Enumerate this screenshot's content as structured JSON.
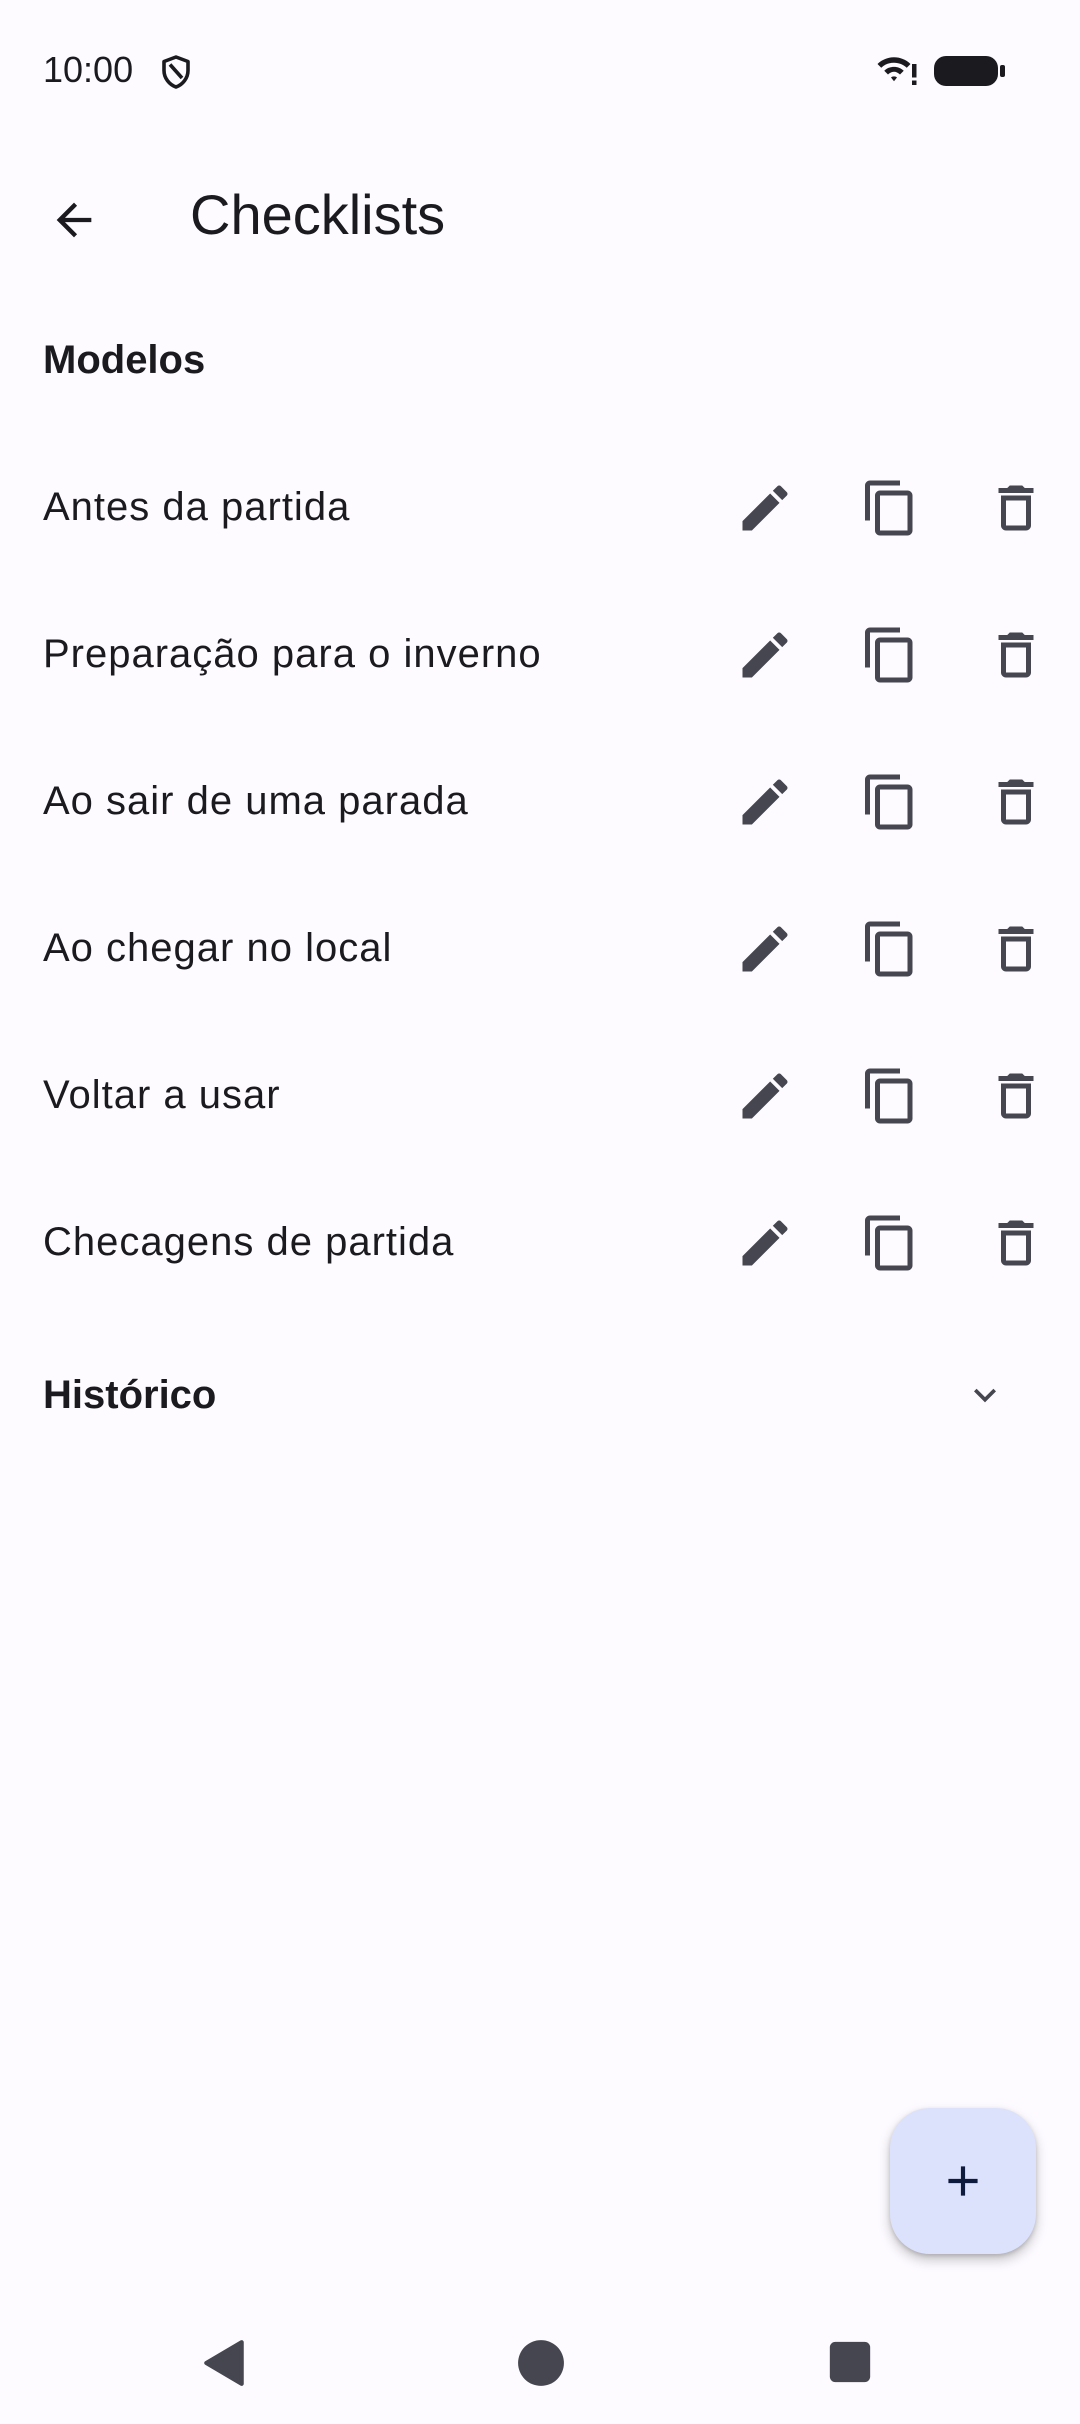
{
  "status_bar": {
    "time": "10:00",
    "icons": [
      "shield-icon",
      "wifi-icon",
      "battery-icon"
    ]
  },
  "app_bar": {
    "title": "Checklists",
    "back_icon": "arrow-back-icon"
  },
  "sections": {
    "models_title": "Modelos",
    "history_title": "Histórico"
  },
  "templates": [
    {
      "label": "Antes da partida"
    },
    {
      "label": "Preparação para o inverno"
    },
    {
      "label": "Ao sair de uma parada"
    },
    {
      "label": "Ao chegar no local"
    },
    {
      "label": "Voltar a usar"
    },
    {
      "label": "Checagens de partida"
    }
  ],
  "row_actions": [
    "edit-icon",
    "copy-icon",
    "delete-icon"
  ],
  "fab": {
    "icon": "plus-icon"
  },
  "colors": {
    "background": "#fdfbff",
    "icon": "#45464f",
    "fab_background": "#dce2fb",
    "fab_icon": "#0f1b3d"
  }
}
